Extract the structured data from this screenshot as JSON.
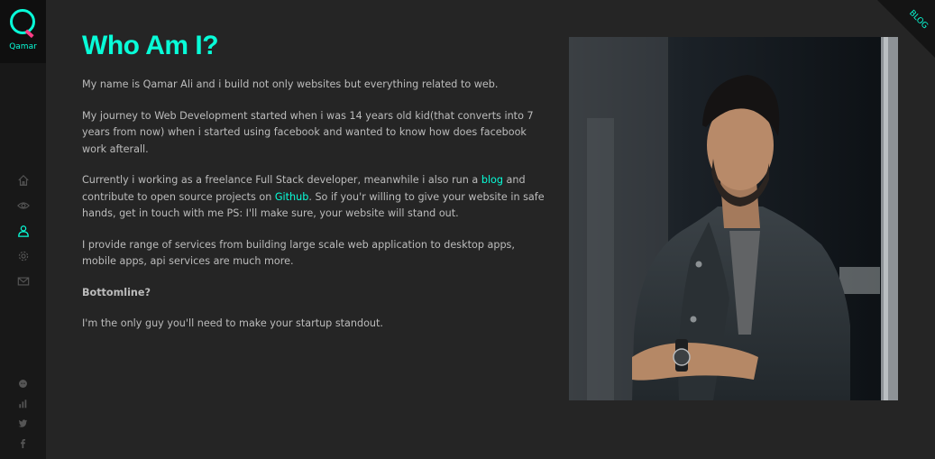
{
  "sidebar": {
    "logo_letter": "Q",
    "logo_name": "Qamar",
    "nav": [
      "home-icon",
      "eye-icon",
      "user-icon",
      "gear-icon",
      "envelope-icon"
    ],
    "social": [
      "github-icon",
      "stats-icon",
      "twitter-icon",
      "facebook-icon"
    ]
  },
  "ribbon": {
    "label": "BLOG"
  },
  "main": {
    "title": "Who Am I?",
    "p1": "My name is Qamar Ali and i build not only websites but everything related to web.",
    "p2": "My journey to Web Development started when i was 14 years old kid(that converts into 7 years from now) when i started using facebook and wanted to know how does facebook work afterall.",
    "p3_a": "Currently i working as a freelance Full Stack developer, meanwhile i also run a ",
    "p3_blog": "blog",
    "p3_b": " and contribute to open source projects on ",
    "p3_github": "Github",
    "p3_c": ". So if you'r willing to give your website in safe hands, get in touch with me PS: I'll make sure, your website will stand out.",
    "p4": "I provide range of services from building large scale web application to desktop apps, mobile apps, api services are much more.",
    "bottom_heading": "Bottomline?",
    "p5": "I'm the only guy you'll need to make your startup standout."
  },
  "colors": {
    "accent": "#08fdd8",
    "logo_tail": "#ff3d86",
    "bg": "#252525",
    "sidebar": "#181818",
    "text": "#bcbcbc"
  }
}
